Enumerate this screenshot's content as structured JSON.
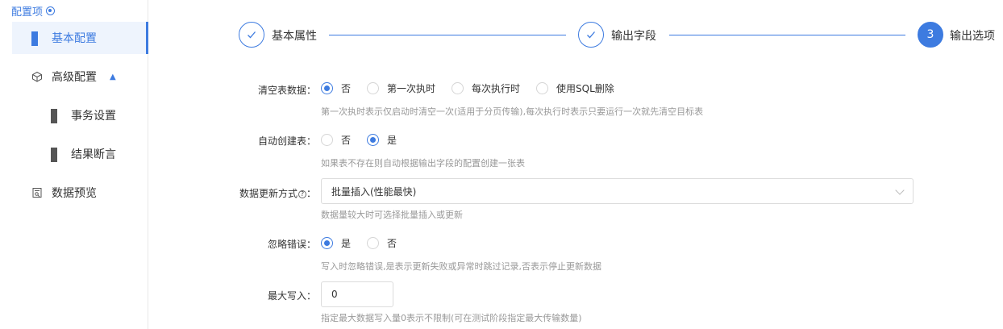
{
  "sidebar": {
    "header": "配置项",
    "items": [
      {
        "label": "基本配置"
      },
      {
        "label": "高级配置"
      },
      {
        "label": "事务设置"
      },
      {
        "label": "结果断言"
      },
      {
        "label": "数据预览"
      }
    ]
  },
  "steps": [
    {
      "label": "基本属性",
      "status": "done"
    },
    {
      "label": "输出字段",
      "status": "done"
    },
    {
      "label": "输出选项",
      "status": "current",
      "number": "3"
    }
  ],
  "form": {
    "clear_table": {
      "label": "清空表数据：",
      "options": [
        "否",
        "第一次执时",
        "每次执行时",
        "使用SQL删除"
      ],
      "selected": "否",
      "help": "第一次执时表示仅启动时清空一次(适用于分页传输),每次执行时表示只要运行一次就先清空目标表"
    },
    "auto_create": {
      "label": "自动创建表：",
      "options": [
        "否",
        "是"
      ],
      "selected": "是",
      "help": "如果表不存在则自动根据输出字段的配置创建一张表"
    },
    "update_mode": {
      "label": "数据更新方式",
      "label_suffix": "：",
      "value": "批量插入(性能最快)",
      "help": "数据量较大时可选择批量插入或更新"
    },
    "ignore_error": {
      "label": "忽略错误：",
      "options": [
        "是",
        "否"
      ],
      "selected": "是",
      "help": "写入时忽略错误,是表示更新失败或异常时跳过记录,否表示停止更新数据"
    },
    "max_write": {
      "label": "最大写入：",
      "value": "0",
      "help": "指定最大数据写入量0表示不限制(可在测试阶段指定最大传输数量)"
    }
  },
  "colors": {
    "accent": "#3d7be0",
    "help_text": "#999999"
  }
}
